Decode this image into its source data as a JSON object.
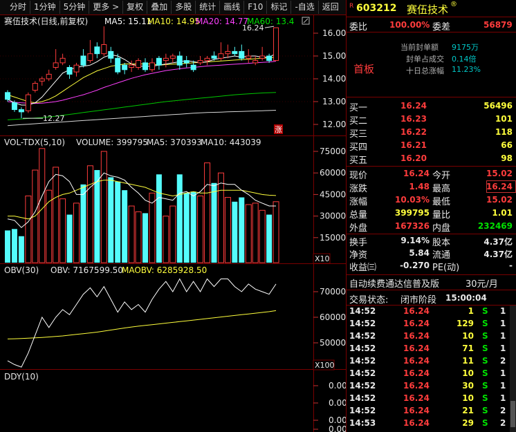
{
  "toolbar": {
    "items": [
      "分时",
      "1分钟",
      "5分钟",
      "更多 >",
      "复权",
      "叠加",
      "多股",
      "统计",
      "画线",
      "F10",
      "标记",
      "-自选",
      "返回"
    ]
  },
  "main_chart": {
    "title": "赛伍技术(日线,前复权)",
    "ma_legend": [
      {
        "label": "MA5: 15.11",
        "color": "#ffffff"
      },
      {
        "label": "MA10: 14.95",
        "color": "#ffff3c"
      },
      {
        "label": "MA20: 14.77",
        "color": "#ff40ff"
      },
      {
        "label": "MA60: 13.4",
        "color": "#00e000"
      }
    ],
    "high_annotation": "16.24",
    "low_annotation": "12.27",
    "limit_up_badge": "涨",
    "y_ticks": [
      "16.00",
      "15.00",
      "14.00",
      "13.00",
      "12.00"
    ],
    "candles": [
      {
        "o": 13.4,
        "c": 13.1,
        "h": 13.5,
        "l": 13.0
      },
      {
        "o": 12.95,
        "c": 12.65,
        "h": 13.05,
        "l": 12.55
      },
      {
        "o": 12.65,
        "c": 12.55,
        "h": 12.75,
        "l": 12.27
      },
      {
        "o": 12.6,
        "c": 13.3,
        "h": 13.4,
        "l": 12.5
      },
      {
        "o": 13.5,
        "c": 13.8,
        "h": 13.9,
        "l": 13.4
      },
      {
        "o": 13.9,
        "c": 14.0,
        "h": 14.1,
        "l": 13.7
      },
      {
        "o": 14.0,
        "c": 14.2,
        "h": 14.4,
        "l": 13.9
      },
      {
        "o": 14.5,
        "c": 14.7,
        "h": 15.3,
        "l": 14.4
      },
      {
        "o": 14.7,
        "c": 14.9,
        "h": 15.1,
        "l": 14.6
      },
      {
        "o": 14.5,
        "c": 14.2,
        "h": 14.6,
        "l": 14.0
      },
      {
        "o": 14.3,
        "c": 14.6,
        "h": 14.7,
        "l": 14.1
      },
      {
        "o": 15.0,
        "c": 14.6,
        "h": 15.3,
        "l": 14.5
      },
      {
        "o": 14.8,
        "c": 15.1,
        "h": 15.7,
        "l": 14.7
      },
      {
        "o": 15.4,
        "c": 15.1,
        "h": 15.6,
        "l": 14.9
      },
      {
        "o": 15.1,
        "c": 15.5,
        "h": 16.3,
        "l": 15.0
      },
      {
        "o": 15.2,
        "c": 14.9,
        "h": 15.4,
        "l": 14.7
      },
      {
        "o": 14.9,
        "c": 14.3,
        "h": 15.1,
        "l": 14.2
      },
      {
        "o": 14.6,
        "c": 14.4,
        "h": 14.7,
        "l": 14.2
      },
      {
        "o": 14.5,
        "c": 14.6,
        "h": 14.8,
        "l": 14.3
      },
      {
        "o": 14.5,
        "c": 14.8,
        "h": 14.9,
        "l": 14.4
      },
      {
        "o": 14.7,
        "c": 14.4,
        "h": 14.9,
        "l": 14.3
      },
      {
        "o": 14.4,
        "c": 14.7,
        "h": 14.9,
        "l": 14.3
      },
      {
        "o": 14.9,
        "c": 14.6,
        "h": 15.0,
        "l": 14.4
      },
      {
        "o": 14.8,
        "c": 14.9,
        "h": 15.1,
        "l": 14.5
      },
      {
        "o": 14.9,
        "c": 15.0,
        "h": 15.1,
        "l": 14.7
      },
      {
        "o": 15.0,
        "c": 14.6,
        "h": 15.2,
        "l": 14.4
      },
      {
        "o": 14.8,
        "c": 14.7,
        "h": 15.0,
        "l": 14.5
      },
      {
        "o": 14.6,
        "c": 14.4,
        "h": 14.8,
        "l": 14.3
      },
      {
        "o": 14.7,
        "c": 14.8,
        "h": 15.0,
        "l": 14.6
      },
      {
        "o": 14.8,
        "c": 14.9,
        "h": 15.0,
        "l": 14.6
      },
      {
        "o": 15.0,
        "c": 14.9,
        "h": 15.2,
        "l": 14.8
      },
      {
        "o": 14.9,
        "c": 15.1,
        "h": 15.6,
        "l": 14.8
      },
      {
        "o": 15.1,
        "c": 15.2,
        "h": 15.5,
        "l": 14.9
      },
      {
        "o": 15.2,
        "c": 15.1,
        "h": 15.4,
        "l": 15.0
      },
      {
        "o": 15.2,
        "c": 14.9,
        "h": 15.5,
        "l": 14.8
      },
      {
        "o": 14.9,
        "c": 15.0,
        "h": 15.3,
        "l": 14.7
      },
      {
        "o": 14.7,
        "c": 14.8,
        "h": 15.0,
        "l": 14.6
      },
      {
        "o": 14.9,
        "c": 15.0,
        "h": 15.4,
        "l": 14.8
      },
      {
        "o": 15.0,
        "c": 14.8,
        "h": 15.1,
        "l": 14.7
      },
      {
        "o": 14.8,
        "c": 16.24,
        "h": 16.24,
        "l": 14.8
      }
    ],
    "ma5": [
      13.1,
      12.95,
      12.85,
      12.85,
      12.95,
      13.2,
      13.55,
      13.9,
      14.25,
      14.4,
      14.5,
      14.55,
      14.6,
      14.75,
      14.95,
      15.05,
      15.0,
      14.85,
      14.65,
      14.55,
      14.55,
      14.55,
      14.6,
      14.65,
      14.7,
      14.75,
      14.8,
      14.75,
      14.7,
      14.75,
      14.85,
      14.9,
      14.95,
      15.0,
      14.95,
      15.0,
      15.0,
      14.95,
      14.95,
      15.11
    ],
    "ma10": [
      13.3,
      13.2,
      13.1,
      13.0,
      12.95,
      13.0,
      13.1,
      13.25,
      13.45,
      13.65,
      13.85,
      14.05,
      14.2,
      14.35,
      14.45,
      14.55,
      14.6,
      14.65,
      14.65,
      14.65,
      14.65,
      14.65,
      14.6,
      14.62,
      14.64,
      14.66,
      14.68,
      14.7,
      14.72,
      14.74,
      14.76,
      14.78,
      14.8,
      14.82,
      14.84,
      14.86,
      14.88,
      14.9,
      14.92,
      14.95
    ],
    "ma20": [
      13.0,
      12.97,
      12.95,
      12.93,
      12.92,
      12.93,
      12.96,
      13.0,
      13.06,
      13.14,
      13.22,
      13.3,
      13.4,
      13.5,
      13.62,
      13.72,
      13.82,
      13.92,
      14.02,
      14.1,
      14.18,
      14.24,
      14.3,
      14.36,
      14.4,
      14.44,
      14.48,
      14.5,
      14.53,
      14.56,
      14.58,
      14.6,
      14.62,
      14.64,
      14.66,
      14.68,
      14.7,
      14.72,
      14.74,
      14.77
    ],
    "ma60": [
      12.2,
      12.22,
      12.24,
      12.26,
      12.28,
      12.3,
      12.33,
      12.36,
      12.4,
      12.44,
      12.48,
      12.52,
      12.56,
      12.6,
      12.64,
      12.68,
      12.72,
      12.76,
      12.8,
      12.84,
      12.88,
      12.92,
      12.96,
      13.0,
      13.03,
      13.06,
      13.09,
      13.12,
      13.15,
      13.18,
      13.21,
      13.24,
      13.27,
      13.3,
      13.32,
      13.34,
      13.36,
      13.38,
      13.39,
      13.4
    ],
    "ma_long": [
      11.95,
      11.97,
      11.99,
      12.01,
      12.03,
      12.05,
      12.07,
      12.09,
      12.11,
      12.13,
      12.15,
      12.17,
      12.19,
      12.21,
      12.23,
      12.25,
      12.27,
      12.29,
      12.31,
      12.33,
      12.35,
      12.37,
      12.39,
      12.41,
      12.43,
      12.45,
      12.47,
      12.49,
      12.51,
      12.52,
      12.53,
      12.54,
      12.55,
      12.56,
      12.57,
      12.58,
      12.59,
      12.6,
      12.61,
      12.62
    ]
  },
  "volume_chart": {
    "title": "VOL-TDX(5,10)",
    "legend": [
      {
        "label": "VOLUME: 399795",
        "color": "#ffffff"
      },
      {
        "label": "MA5: 370393",
        "color": "#ffffff"
      },
      {
        "label": "MA10: 443039",
        "color": "#ffffff"
      }
    ],
    "y_ticks": [
      "75000",
      "60000",
      "45000",
      "30000",
      "15000"
    ],
    "unit": "X10",
    "volume": [
      20000,
      21000,
      16000,
      44000,
      62000,
      77000,
      48000,
      64000,
      42000,
      31000,
      39000,
      52000,
      65000,
      62000,
      75000,
      57000,
      54000,
      48000,
      37000,
      33000,
      32000,
      46000,
      59000,
      30000,
      37000,
      59000,
      46000,
      47000,
      44000,
      67000,
      53000,
      60000,
      43000,
      40000,
      43000,
      38000,
      39000,
      34000,
      31000,
      40000
    ],
    "vma5": [
      28000,
      27000,
      22000,
      26000,
      33000,
      44000,
      54000,
      59000,
      58000,
      54000,
      45000,
      45000,
      50000,
      54000,
      60000,
      58000,
      57000,
      55000,
      50000,
      46000,
      41000,
      39000,
      43000,
      42000,
      41000,
      46000,
      47000,
      44000,
      47000,
      52000,
      51000,
      53000,
      52000,
      52000,
      48000,
      45000,
      41000,
      39000,
      37000,
      37000
    ],
    "vma10": [
      30000,
      30000,
      29000,
      28000,
      30000,
      35000,
      40000,
      43000,
      45000,
      46000,
      48000,
      50000,
      52000,
      54000,
      55000,
      55000,
      54000,
      53000,
      52000,
      51000,
      50000,
      48000,
      46000,
      45000,
      44000,
      45000,
      46000,
      47000,
      46000,
      46000,
      47000,
      48000,
      48000,
      48000,
      48000,
      47000,
      46000,
      45000,
      44500,
      44300
    ]
  },
  "obv_chart": {
    "title": "OBV(30)",
    "legend": [
      {
        "label": "OBV: 7167599.50",
        "color": "#ffffff"
      },
      {
        "label": "MAOBV: 6285928.50",
        "color": "#ffff3c"
      }
    ],
    "y_ticks": [
      "70000",
      "60000",
      "50000"
    ],
    "unit": "X100",
    "obv": [
      43000,
      41500,
      40500,
      46000,
      53000,
      60000,
      56000,
      60000,
      63000,
      61000,
      65000,
      69000,
      71500,
      68000,
      72000,
      67000,
      62000,
      66000,
      63000,
      65000,
      62000,
      67000,
      71000,
      74000,
      70000,
      75000,
      70000,
      74000,
      70000,
      75000,
      72000,
      75000,
      75000,
      72000,
      70000,
      73000,
      71000,
      70000,
      69000,
      73000
    ],
    "maobv": [
      51500,
      51600,
      51700,
      51800,
      51950,
      52100,
      52300,
      52500,
      52700,
      53000,
      53300,
      53600,
      53900,
      54200,
      54600,
      55000,
      55400,
      55800,
      56200,
      56500,
      56800,
      57100,
      57400,
      57700,
      58000,
      58300,
      58600,
      58900,
      59200,
      59500,
      59800,
      60100,
      60400,
      60700,
      61000,
      61300,
      61600,
      61900,
      62200,
      62600
    ]
  },
  "ddy_chart": {
    "title": "DDY(10)",
    "y_ticks": [
      "0.00",
      "0.00",
      "0.00",
      "0.00"
    ]
  },
  "quote": {
    "badge": "R",
    "code": "603212",
    "name": "赛伍技术",
    "name_badge": "®",
    "wei_bi_label": "委比",
    "wei_bi_value": "100.00%",
    "wei_cha_label": "委差",
    "wei_cha_value": "56879",
    "sealing_amount_label": "当前封单额",
    "sealing_amount_value": "9175万",
    "sealing_ratio_label": "封单占成交",
    "sealing_ratio_value": "0.14倍",
    "ten_day_label": "十日总涨幅",
    "ten_day_value": "11.23%",
    "board_label": "首板",
    "bids": [
      {
        "label": "买一",
        "price": "16.24",
        "vol": "56496"
      },
      {
        "label": "买二",
        "price": "16.23",
        "vol": "101"
      },
      {
        "label": "买三",
        "price": "16.22",
        "vol": "118"
      },
      {
        "label": "买四",
        "price": "16.21",
        "vol": "66"
      },
      {
        "label": "买五",
        "price": "16.20",
        "vol": "98"
      }
    ],
    "stats": [
      {
        "l1": "现价",
        "v1": "16.24",
        "c1": "red",
        "l2": "今开",
        "v2": "15.02",
        "c2": "red"
      },
      {
        "l1": "涨跌",
        "v1": "1.48",
        "c1": "red",
        "l2": "最高",
        "v2": "16.24",
        "c2": "red"
      },
      {
        "l1": "涨幅",
        "v1": "10.03%",
        "c1": "red",
        "l2": "最低",
        "v2": "15.02",
        "c2": "red"
      },
      {
        "l1": "总量",
        "v1": "399795",
        "c1": "yellow",
        "l2": "量比",
        "v2": "1.01",
        "c2": "yellow"
      },
      {
        "l1": "外盘",
        "v1": "167326",
        "c1": "red",
        "l2": "内盘",
        "v2": "232469",
        "c2": "green"
      }
    ],
    "stats2": [
      {
        "l1": "换手",
        "v1": "9.14%",
        "c1": "white",
        "l2": "股本",
        "v2": "4.37亿",
        "c2": "white"
      },
      {
        "l1": "净资",
        "v1": "5.84",
        "c1": "white",
        "l2": "流通",
        "v2": "4.37亿",
        "c2": "white"
      },
      {
        "l1": "收益㈢",
        "v1": "-0.270",
        "c1": "white",
        "l2": "PE(动)",
        "v2": "-",
        "c2": "white"
      }
    ],
    "promo_text": "自动续费通达信普及版",
    "promo_price": "30元/月",
    "status_label": "交易状态:",
    "status_value": "闭市阶段",
    "status_time": "15:00:04",
    "ticks": [
      {
        "t": "14:52",
        "p": "16.24",
        "v": "1",
        "s": "S",
        "n": "1"
      },
      {
        "t": "14:52",
        "p": "16.24",
        "v": "129",
        "s": "S",
        "n": "1"
      },
      {
        "t": "14:52",
        "p": "16.24",
        "v": "10",
        "s": "S",
        "n": "1"
      },
      {
        "t": "14:52",
        "p": "16.24",
        "v": "71",
        "s": "S",
        "n": "1"
      },
      {
        "t": "14:52",
        "p": "16.24",
        "v": "11",
        "s": "S",
        "n": "2"
      },
      {
        "t": "14:52",
        "p": "16.24",
        "v": "10",
        "s": "S",
        "n": "1"
      },
      {
        "t": "14:52",
        "p": "16.24",
        "v": "30",
        "s": "S",
        "n": "1"
      },
      {
        "t": "14:52",
        "p": "16.24",
        "v": "10",
        "s": "S",
        "n": "1"
      },
      {
        "t": "14:52",
        "p": "16.24",
        "v": "21",
        "s": "S",
        "n": "2"
      },
      {
        "t": "14:53",
        "p": "16.24",
        "v": "29",
        "s": "S",
        "n": "2"
      }
    ]
  }
}
